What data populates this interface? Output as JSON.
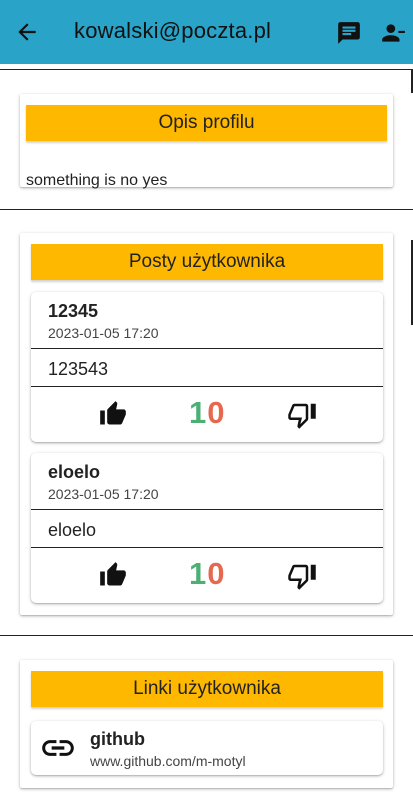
{
  "appbar": {
    "title": "kowalski@poczta.pl",
    "color": "#29a3c7",
    "icons": [
      "arrow-back-icon",
      "chat-icon",
      "person-remove-icon"
    ]
  },
  "profile": {
    "header": "Opis profilu",
    "description": "something is no yes"
  },
  "posts": {
    "header": "Posty użytkownika",
    "items": [
      {
        "title": "12345",
        "date": "2023-01-05 17:20",
        "body": "123543",
        "score_digits": [
          "1",
          "0"
        ]
      },
      {
        "title": "eloelo",
        "date": "2023-01-05 17:20",
        "body": "eloelo",
        "score_digits": [
          "1",
          "0"
        ]
      }
    ]
  },
  "links": {
    "header": "Linki użytkownika",
    "items": [
      {
        "name": "github",
        "url": "www.github.com/m-motyl",
        "icon": "link-icon"
      }
    ]
  },
  "colors": {
    "banner": "#ffb800",
    "score_positive": "#4caf73",
    "score_negative": "#e5684f"
  }
}
